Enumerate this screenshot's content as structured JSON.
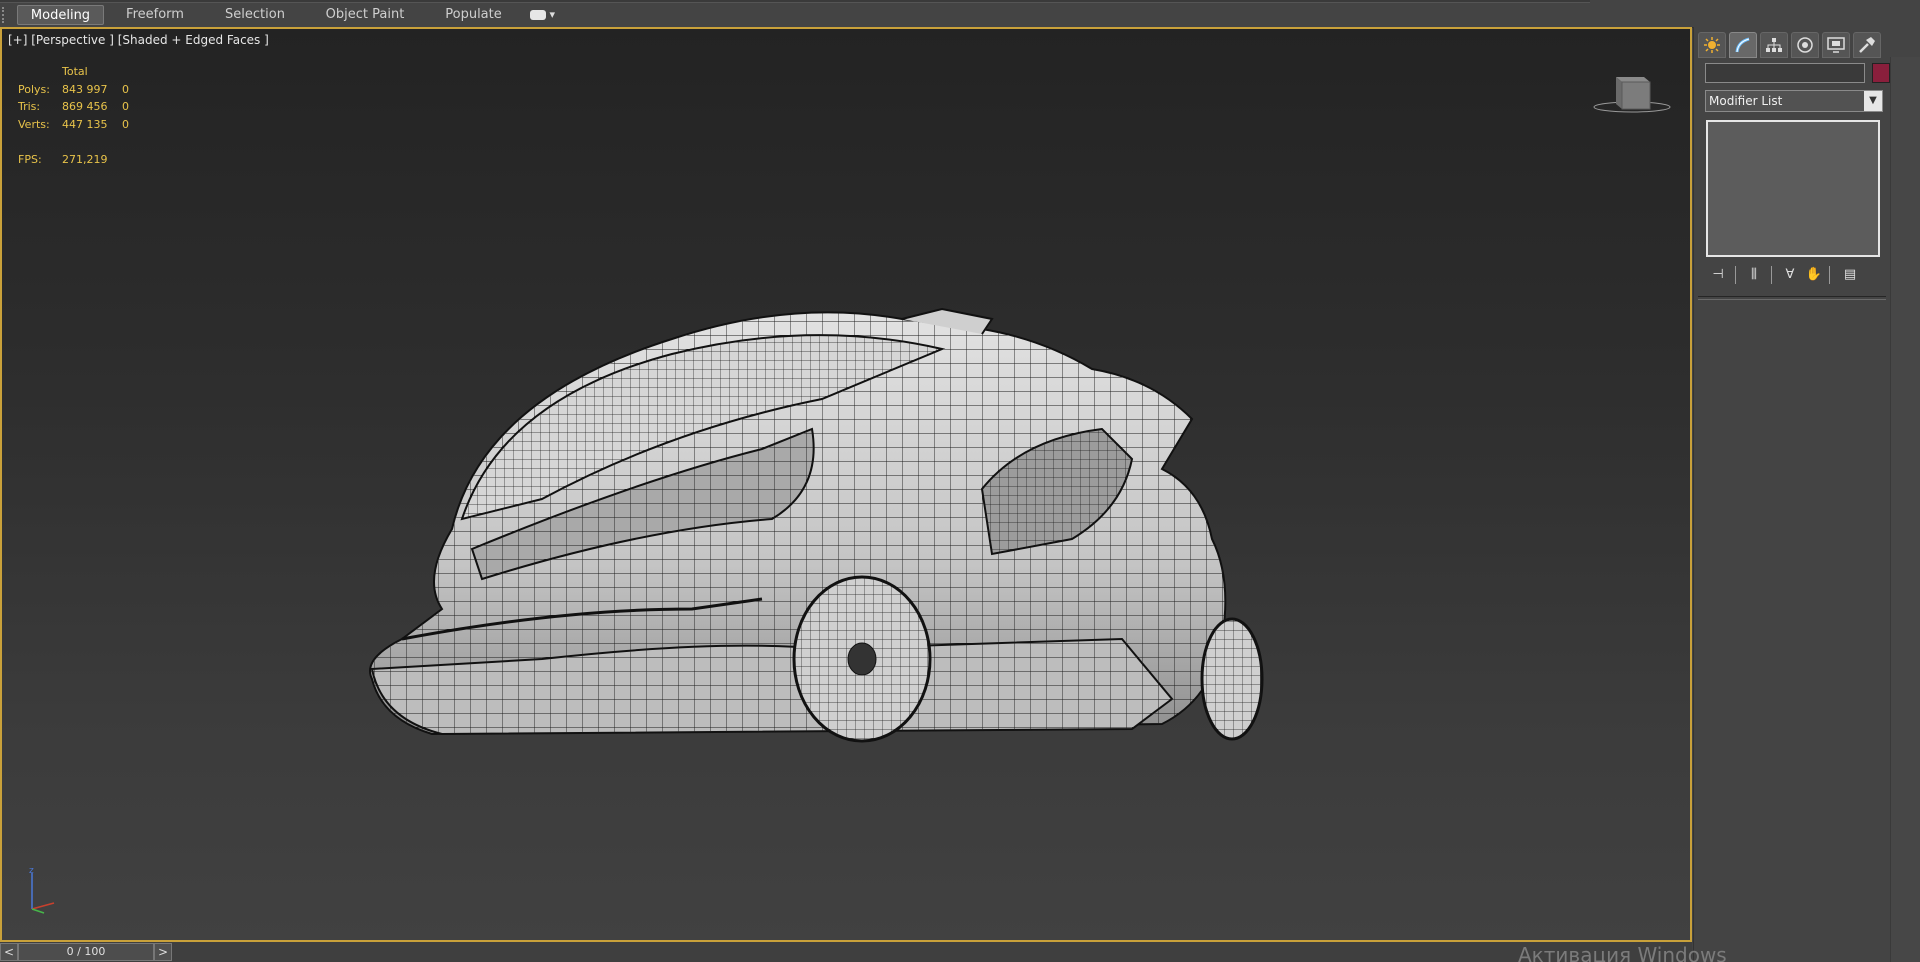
{
  "ribbon": {
    "tabs": [
      {
        "label": "Modeling",
        "active": true
      },
      {
        "label": "Freeform",
        "active": false
      },
      {
        "label": "Selection",
        "active": false
      },
      {
        "label": "Object Paint",
        "active": false
      },
      {
        "label": "Populate",
        "active": false
      }
    ]
  },
  "viewport": {
    "label": "[+] [Perspective ] [Shaded + Edged Faces ]",
    "border_color": "#c9a13a",
    "stats": {
      "header": "Total",
      "rows": [
        {
          "label": "Polys:",
          "total": "843 997",
          "selected": "0"
        },
        {
          "label": "Tris:",
          "total": "869 456",
          "selected": "0"
        },
        {
          "label": "Verts:",
          "total": "447 135",
          "selected": "0"
        }
      ],
      "fps_label": "FPS:",
      "fps_value": "271,219",
      "color": "#e8c34a"
    },
    "viewcube_icon": "viewcube-icon",
    "axis_icon": "axis-tripod-icon",
    "model": "wireframe-shaded-car-model"
  },
  "command_panel": {
    "tabs": [
      {
        "icon": "create-icon",
        "active": false
      },
      {
        "icon": "modify-icon",
        "active": true
      },
      {
        "icon": "hierarchy-icon",
        "active": false
      },
      {
        "icon": "motion-icon",
        "active": false
      },
      {
        "icon": "display-icon",
        "active": false
      },
      {
        "icon": "utilities-icon",
        "active": false
      }
    ],
    "name_value": "",
    "object_color": "#8a1f3c",
    "modifier_list_label": "Modifier List",
    "stack_tools": [
      "pin-stack-icon",
      "show-end-result-icon",
      "make-unique-icon",
      "remove-modifier-icon",
      "configure-modifier-sets-icon"
    ]
  },
  "timeline": {
    "prev": "<",
    "frame": "0 / 100",
    "next": ">"
  },
  "watermark": "Активация Windows"
}
